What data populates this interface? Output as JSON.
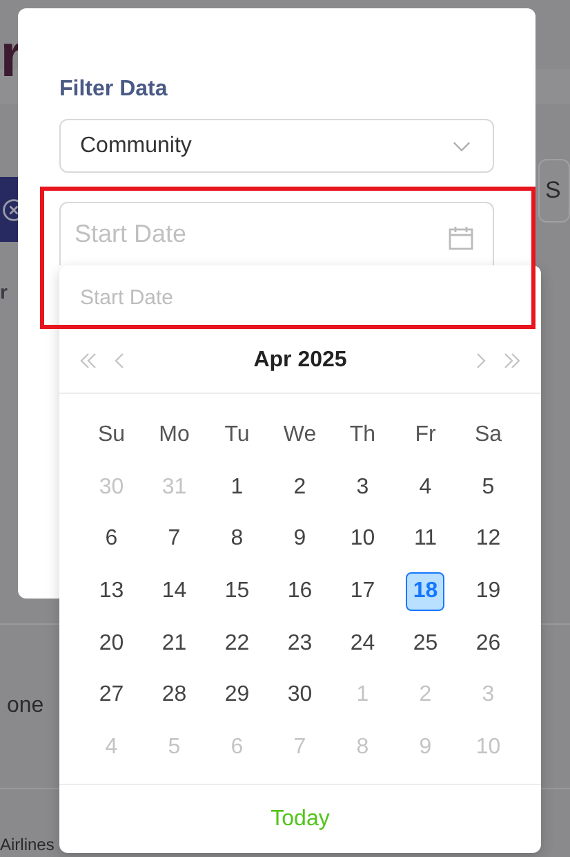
{
  "background": {
    "heading_fragment": "r",
    "button_fragment": "S",
    "texts": [
      "r",
      "one",
      "Airlines"
    ]
  },
  "modal": {
    "title": "Filter Data",
    "select": {
      "value": "Community"
    },
    "date_field": {
      "placeholder": "Start Date",
      "highlighted": true
    }
  },
  "date_picker": {
    "input_placeholder": "Start Date",
    "month": "Apr 2025",
    "weekdays": [
      "Su",
      "Mo",
      "Tu",
      "We",
      "Th",
      "Fr",
      "Sa"
    ],
    "weeks": [
      [
        {
          "day": "30",
          "in_month": false,
          "selected": false
        },
        {
          "day": "31",
          "in_month": false,
          "selected": false
        },
        {
          "day": "1",
          "in_month": true,
          "selected": false
        },
        {
          "day": "2",
          "in_month": true,
          "selected": false
        },
        {
          "day": "3",
          "in_month": true,
          "selected": false
        },
        {
          "day": "4",
          "in_month": true,
          "selected": false
        },
        {
          "day": "5",
          "in_month": true,
          "selected": false
        }
      ],
      [
        {
          "day": "6",
          "in_month": true,
          "selected": false
        },
        {
          "day": "7",
          "in_month": true,
          "selected": false
        },
        {
          "day": "8",
          "in_month": true,
          "selected": false
        },
        {
          "day": "9",
          "in_month": true,
          "selected": false
        },
        {
          "day": "10",
          "in_month": true,
          "selected": false
        },
        {
          "day": "11",
          "in_month": true,
          "selected": false
        },
        {
          "day": "12",
          "in_month": true,
          "selected": false
        }
      ],
      [
        {
          "day": "13",
          "in_month": true,
          "selected": false
        },
        {
          "day": "14",
          "in_month": true,
          "selected": false
        },
        {
          "day": "15",
          "in_month": true,
          "selected": false
        },
        {
          "day": "16",
          "in_month": true,
          "selected": false
        },
        {
          "day": "17",
          "in_month": true,
          "selected": false
        },
        {
          "day": "18",
          "in_month": true,
          "selected": true
        },
        {
          "day": "19",
          "in_month": true,
          "selected": false
        }
      ],
      [
        {
          "day": "20",
          "in_month": true,
          "selected": false
        },
        {
          "day": "21",
          "in_month": true,
          "selected": false
        },
        {
          "day": "22",
          "in_month": true,
          "selected": false
        },
        {
          "day": "23",
          "in_month": true,
          "selected": false
        },
        {
          "day": "24",
          "in_month": true,
          "selected": false
        },
        {
          "day": "25",
          "in_month": true,
          "selected": false
        },
        {
          "day": "26",
          "in_month": true,
          "selected": false
        }
      ],
      [
        {
          "day": "27",
          "in_month": true,
          "selected": false
        },
        {
          "day": "28",
          "in_month": true,
          "selected": false
        },
        {
          "day": "29",
          "in_month": true,
          "selected": false
        },
        {
          "day": "30",
          "in_month": true,
          "selected": false
        },
        {
          "day": "1",
          "in_month": false,
          "selected": false
        },
        {
          "day": "2",
          "in_month": false,
          "selected": false
        },
        {
          "day": "3",
          "in_month": false,
          "selected": false
        }
      ],
      [
        {
          "day": "4",
          "in_month": false,
          "selected": false
        },
        {
          "day": "5",
          "in_month": false,
          "selected": false
        },
        {
          "day": "6",
          "in_month": false,
          "selected": false
        },
        {
          "day": "7",
          "in_month": false,
          "selected": false
        },
        {
          "day": "8",
          "in_month": false,
          "selected": false
        },
        {
          "day": "9",
          "in_month": false,
          "selected": false
        },
        {
          "day": "10",
          "in_month": false,
          "selected": false
        }
      ]
    ],
    "footer": "Today"
  }
}
